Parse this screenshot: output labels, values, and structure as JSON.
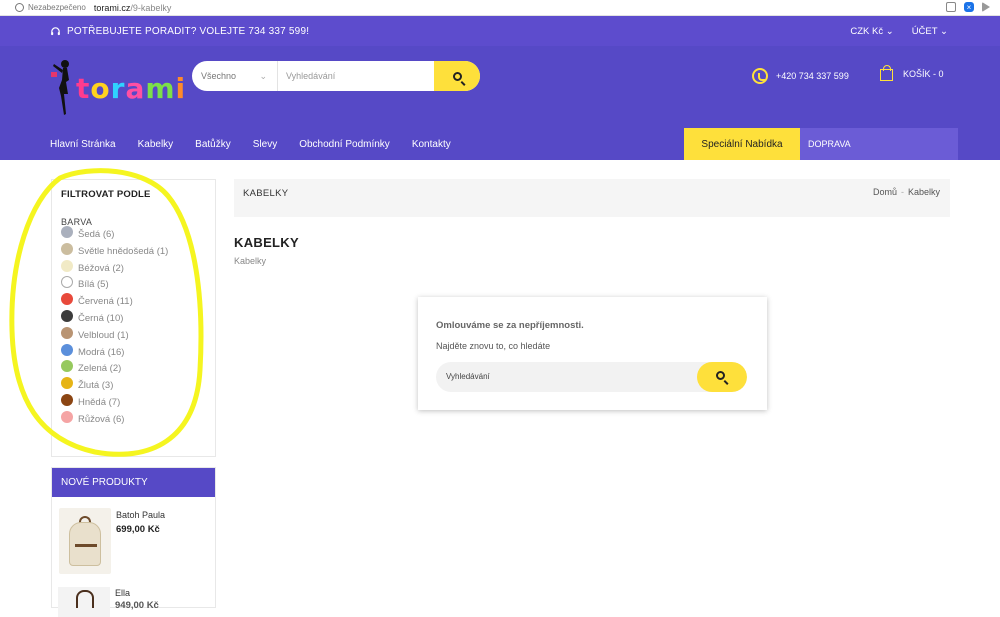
{
  "browser": {
    "security_label": "Nezabezpečeno",
    "url_host": "torami.cz",
    "url_path": "/9-kabelky"
  },
  "topbar": {
    "help_text": "POTŘEBUJETE PORADIT? VOLEJTE 734 337 599!",
    "currency": "CZK Kč",
    "account": "ÚČET"
  },
  "header": {
    "logo_text": "torami",
    "search_category": "Všechno",
    "search_placeholder": "Vyhledávání",
    "phone": "+420 734 337 599",
    "cart_label": "KOŠÍK - 0"
  },
  "nav": {
    "items": [
      "Hlavní Stránka",
      "Kabelky",
      "Batůžky",
      "Slevy",
      "Obchodní Podmínky",
      "Kontakty"
    ],
    "special": "Speciální Nabídka",
    "shipping": "DOPRAVA"
  },
  "filter": {
    "title": "FILTROVAT PODLE",
    "group": "BARVA",
    "colors": [
      {
        "label": "Šedá (6)",
        "color": "#aab0bd"
      },
      {
        "label": "Světle hnědošedá (1)",
        "color": "#cbbd9f"
      },
      {
        "label": "Béžová (2)",
        "color": "#f1eac6"
      },
      {
        "label": "Bílá (5)",
        "color": "#ffffff"
      },
      {
        "label": "Červená (11)",
        "color": "#e8493b"
      },
      {
        "label": "Černá (10)",
        "color": "#3c3c3c"
      },
      {
        "label": "Velbloud (1)",
        "color": "#b99473"
      },
      {
        "label": "Modrá (16)",
        "color": "#5b8fdb"
      },
      {
        "label": "Zelená (2)",
        "color": "#96c95e"
      },
      {
        "label": "Žlutá (3)",
        "color": "#e6b416"
      },
      {
        "label": "Hnědá (7)",
        "color": "#8b4513"
      },
      {
        "label": "Růžová (6)",
        "color": "#f5a4a4"
      }
    ]
  },
  "new_products": {
    "title": "NOVÉ PRODUKTY",
    "items": [
      {
        "name": "Batoh Paula",
        "price": "699,00 Kč"
      },
      {
        "name": "Ella",
        "price": "949,00 Kč"
      }
    ]
  },
  "main": {
    "category_bar_title": "KABELKY",
    "breadcrumb": [
      "Domů",
      "Kabelky"
    ],
    "page_title": "KABELKY",
    "page_subtitle": "Kabelky",
    "notice_title": "Omlouváme se za nepříjemnosti.",
    "notice_text": "Najděte znovu to, co hledáte",
    "notice_search_placeholder": "Vyhledávání"
  },
  "colors": {
    "brand_purple": "#5649c6",
    "accent_yellow": "#fee03b",
    "annotation_yellow": "#f5f520"
  }
}
